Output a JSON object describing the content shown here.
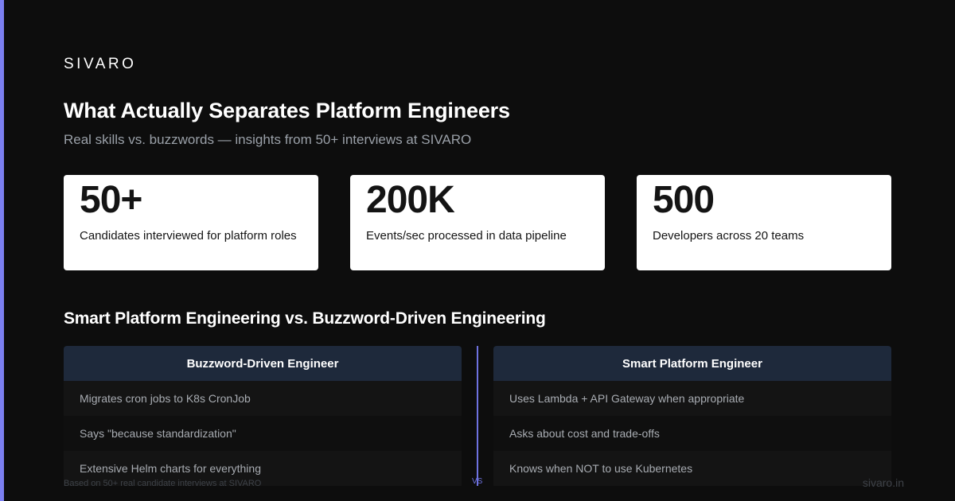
{
  "brand": "SIVARO",
  "title": "What Actually Separates Platform Engineers",
  "subtitle": "Real skills vs. buzzwords — insights from 50+ interviews at SIVARO",
  "stats": [
    {
      "value": "50+",
      "label": "Candidates interviewed for platform roles"
    },
    {
      "value": "200K",
      "label": "Events/sec processed in data pipeline"
    },
    {
      "value": "500",
      "label": "Developers across 20 teams"
    }
  ],
  "comparison": {
    "title": "Smart Platform Engineering vs. Buzzword-Driven Engineering",
    "left": {
      "header": "Buzzword-Driven Engineer",
      "rows": [
        "Migrates cron jobs to K8s CronJob",
        "Says \"because standardization\"",
        "Extensive Helm charts for everything"
      ]
    },
    "right": {
      "header": "Smart Platform Engineer",
      "rows": [
        "Uses Lambda + API Gateway when appropriate",
        "Asks about cost and trade-offs",
        "Knows when NOT to use Kubernetes"
      ]
    },
    "divider_label": "VS"
  },
  "footer": {
    "note": "Based on 50+ real candidate interviews at SIVARO",
    "site": "sivaro.in"
  },
  "colors": {
    "background": "#0d0d0d",
    "accent": "#7b7ff0",
    "card": "#ffffff",
    "column_header": "#1e293b"
  }
}
